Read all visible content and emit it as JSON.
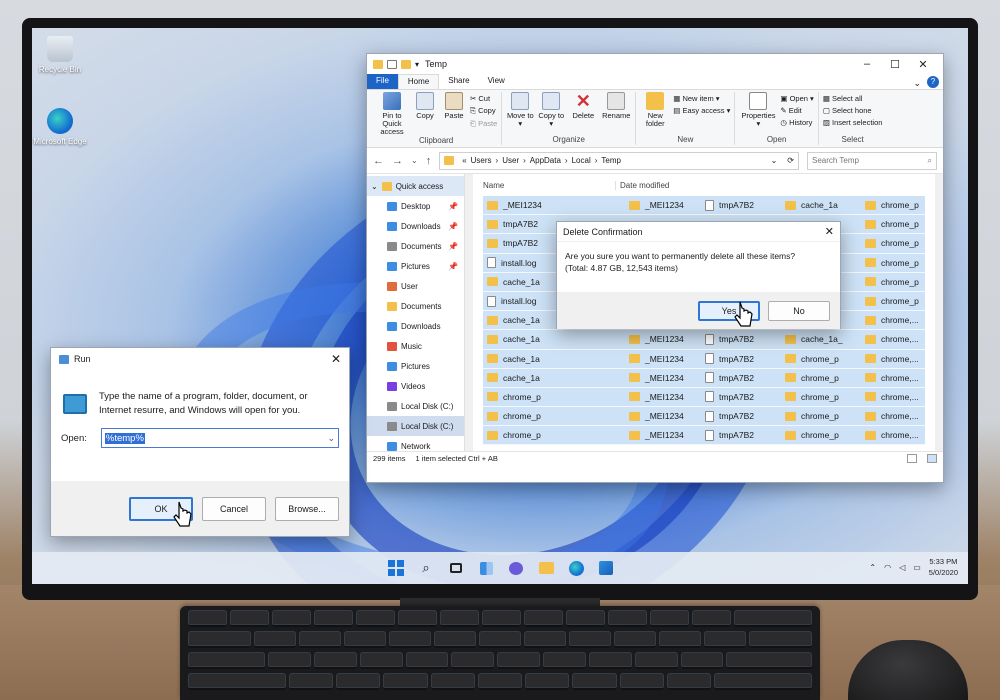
{
  "desktop": {
    "icons": [
      {
        "label": "Recycle Bin",
        "icon": "recycle-bin-icon"
      },
      {
        "label": "Microsoft Edge",
        "icon": "edge-icon"
      }
    ]
  },
  "explorer": {
    "title": "Temp",
    "ribbon_tabs": [
      "File",
      "Home",
      "Share",
      "View"
    ],
    "clipboard": {
      "pin": "Pin to Quick access",
      "copy": "Copy",
      "paste": "Paste",
      "cut": "Cut",
      "copy2": "Copy",
      "paste2": "Paste",
      "label": "Clipboard"
    },
    "organize": {
      "move": "Move to",
      "copy": "Copy to",
      "delete": "Delete",
      "rename": "Rename",
      "label": "Organize"
    },
    "new": {
      "folder": "New folder",
      "item": "New item",
      "easy": "Easy access",
      "label": "New"
    },
    "open": {
      "properties": "Properties",
      "open": "Open",
      "edit": "Edit",
      "history": "History",
      "label": "Open"
    },
    "select": {
      "all": "Select all",
      "none": "Select hone",
      "invert": "Insert selection",
      "label": "Select"
    },
    "breadcrumb": [
      "Users",
      "User",
      "AppData",
      "Local",
      "Temp"
    ],
    "search_placeholder": "Search Temp",
    "nav": [
      {
        "label": "Quick access",
        "pin": ""
      },
      {
        "label": "Desktop",
        "pin": "📌"
      },
      {
        "label": "Downloads",
        "pin": "📌"
      },
      {
        "label": "Documents",
        "pin": "📌"
      },
      {
        "label": "Pictures",
        "pin": "📌"
      },
      {
        "label": "User",
        "pin": ""
      },
      {
        "label": "Documents",
        "pin": ""
      },
      {
        "label": "Downloads",
        "pin": ""
      },
      {
        "label": "Music",
        "pin": ""
      },
      {
        "label": "Pictures",
        "pin": ""
      },
      {
        "label": "Videos",
        "pin": ""
      },
      {
        "label": "Local Disk (C:)",
        "pin": ""
      },
      {
        "label": "Local Disk (C:)",
        "pin": ""
      },
      {
        "label": "Network",
        "pin": ""
      }
    ],
    "columns": {
      "name": "Name",
      "date": "Date modified"
    },
    "rows": [
      [
        {
          "n": "_MEI1234",
          "t": "folder"
        },
        {
          "n": "_MEI1234",
          "t": "folder"
        },
        {
          "n": "tmpA7B2",
          "t": "file"
        },
        {
          "n": "cache_1a",
          "t": "folder"
        },
        {
          "n": "chrome_p",
          "t": "folder"
        }
      ],
      [
        {
          "n": "tmpA7B2",
          "t": "folder"
        },
        {
          "n": "",
          "t": ""
        },
        {
          "n": "",
          "t": ""
        },
        {
          "n": "",
          "t": ""
        },
        {
          "n": "chrome_p",
          "t": "folder"
        }
      ],
      [
        {
          "n": "tmpA7B2",
          "t": "folder"
        },
        {
          "n": "",
          "t": ""
        },
        {
          "n": "",
          "t": ""
        },
        {
          "n": "",
          "t": ""
        },
        {
          "n": "chrome_p",
          "t": "folder"
        }
      ],
      [
        {
          "n": "install.log",
          "t": "file"
        },
        {
          "n": "",
          "t": ""
        },
        {
          "n": "",
          "t": ""
        },
        {
          "n": "",
          "t": ""
        },
        {
          "n": "chrome_p",
          "t": "folder"
        }
      ],
      [
        {
          "n": "cache_1a",
          "t": "folder"
        },
        {
          "n": "",
          "t": ""
        },
        {
          "n": "",
          "t": ""
        },
        {
          "n": "",
          "t": ""
        },
        {
          "n": "chrome_p",
          "t": "folder"
        }
      ],
      [
        {
          "n": "install.log",
          "t": "file"
        },
        {
          "n": "",
          "t": ""
        },
        {
          "n": "",
          "t": ""
        },
        {
          "n": "",
          "t": ""
        },
        {
          "n": "chrome_p",
          "t": "folder"
        }
      ],
      [
        {
          "n": "cache_1a",
          "t": "folder"
        },
        {
          "n": "_MEI1234",
          "t": "folder"
        },
        {
          "n": "tmpA7B2",
          "t": "file"
        },
        {
          "n": "chrome_p",
          "t": "folder"
        },
        {
          "n": "chrome,...",
          "t": "folder"
        }
      ],
      [
        {
          "n": "cache_1a",
          "t": "folder"
        },
        {
          "n": "_MEI1234",
          "t": "folder"
        },
        {
          "n": "tmpA7B2",
          "t": "file"
        },
        {
          "n": "cache_1a_",
          "t": "folder"
        },
        {
          "n": "chrome,...",
          "t": "folder"
        }
      ],
      [
        {
          "n": "cache_1a",
          "t": "folder"
        },
        {
          "n": "_MEI1234",
          "t": "folder"
        },
        {
          "n": "tmpA7B2",
          "t": "file"
        },
        {
          "n": "chrome_p",
          "t": "folder"
        },
        {
          "n": "chrome,...",
          "t": "folder"
        }
      ],
      [
        {
          "n": "cache_1a",
          "t": "folder"
        },
        {
          "n": "_MEI1234",
          "t": "folder"
        },
        {
          "n": "tmpA7B2",
          "t": "file"
        },
        {
          "n": "chrome_p",
          "t": "folder"
        },
        {
          "n": "chrome,...",
          "t": "folder"
        }
      ],
      [
        {
          "n": "chrome_p",
          "t": "folder"
        },
        {
          "n": "_MEI1234",
          "t": "folder"
        },
        {
          "n": "tmpA7B2",
          "t": "file"
        },
        {
          "n": "chrome_p",
          "t": "folder"
        },
        {
          "n": "chrome,...",
          "t": "folder"
        }
      ],
      [
        {
          "n": "chrome_p",
          "t": "folder"
        },
        {
          "n": "_MEI1234",
          "t": "folder"
        },
        {
          "n": "tmpA7B2",
          "t": "file"
        },
        {
          "n": "chrome_p",
          "t": "folder"
        },
        {
          "n": "chrome,...",
          "t": "folder"
        }
      ],
      [
        {
          "n": "chrome_p",
          "t": "folder"
        },
        {
          "n": "_MEI1234",
          "t": "folder"
        },
        {
          "n": "tmpA7B2",
          "t": "file"
        },
        {
          "n": "chrome_p",
          "t": "folder"
        },
        {
          "n": "chrome,...",
          "t": "folder"
        }
      ]
    ],
    "status": {
      "count": "299 items",
      "selected": "1 item selected Ctrl + AB"
    }
  },
  "delete_dialog": {
    "title": "Delete Confirmation",
    "message": "Are you sure you want to permanently delete all these items?",
    "detail": "(Total: 4.87 GB, 12,543 items)",
    "yes": "Yes",
    "no": "No"
  },
  "run_dialog": {
    "title": "Run",
    "description": "Type the name of a program, folder, document, or Internet resurre, and Windows will open for you.",
    "open_label": "Open:",
    "value": "%temp%",
    "ok": "OK",
    "cancel": "Cancel",
    "browse": "Browse..."
  },
  "taskbar": {
    "time": "5:33 PM",
    "date": "5/0/2020"
  },
  "colors": {
    "accent": "#1c65c6",
    "selection": "#cde2f6",
    "folder": "#f3c14b"
  }
}
